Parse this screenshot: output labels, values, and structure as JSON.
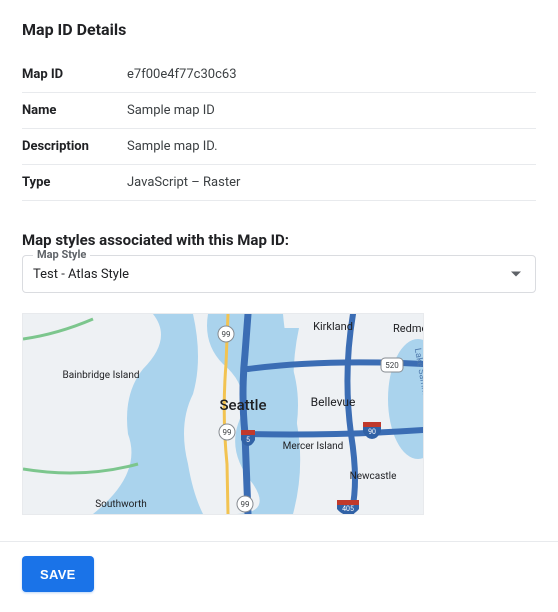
{
  "header": {
    "title": "Map ID Details"
  },
  "details": {
    "rows": [
      {
        "label": "Map ID",
        "value": "e7f00e4f77c30c63"
      },
      {
        "label": "Name",
        "value": "Sample map ID"
      },
      {
        "label": "Description",
        "value": "Sample map ID."
      },
      {
        "label": "Type",
        "value": "JavaScript – Raster"
      }
    ]
  },
  "styles_section": {
    "title": "Map styles associated with this Map ID:",
    "select_label": "Map Style",
    "select_value": "Test - Atlas Style"
  },
  "map_preview": {
    "cities": [
      {
        "name": "Seattle",
        "size": 15
      },
      {
        "name": "Bellevue",
        "size": 12
      },
      {
        "name": "Kirkland",
        "size": 11
      },
      {
        "name": "Redmond",
        "size": 11
      },
      {
        "name": "Bainbridge Island",
        "size": 10
      },
      {
        "name": "Mercer Island",
        "size": 10
      },
      {
        "name": "Newcastle",
        "size": 10
      },
      {
        "name": "Southworth",
        "size": 10
      }
    ],
    "highway_shields": [
      "99",
      "520",
      "90",
      "99",
      "5",
      "99",
      "405"
    ]
  },
  "footer": {
    "save_label": "SAVE"
  }
}
